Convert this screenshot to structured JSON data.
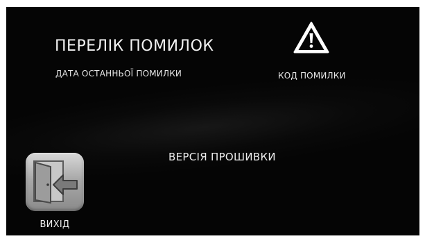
{
  "screen": {
    "title": "ПЕРЕЛІК ПОМИЛОК",
    "last_error_date_label": "ДАТА ОСТАННЬОЇ ПОМИЛКИ",
    "error_code_label": "КОД ПОМИЛКИ",
    "firmware_version_label": "ВЕРСІЯ ПРОШИВКИ"
  },
  "exit_button": {
    "label": "ВИХІД",
    "icon": "exit-door-icon"
  },
  "warning": {
    "icon": "warning-triangle-icon"
  },
  "colors": {
    "background": "#050505",
    "text": "#f2f2f2",
    "tile": "#a9a9a9"
  }
}
